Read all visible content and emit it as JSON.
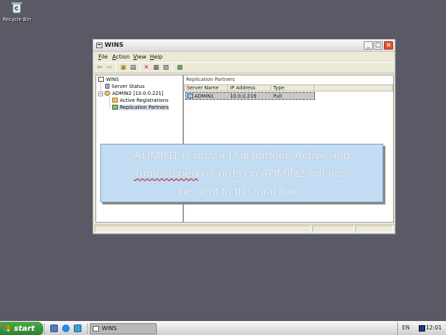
{
  "desktop": {
    "icons": [
      {
        "label": "Recycle Bin",
        "icon": "recycle-bin-icon"
      }
    ]
  },
  "window": {
    "title": "WINS",
    "menu": [
      "File",
      "Action",
      "View",
      "Help"
    ],
    "toolbar_icons": [
      "back-arrow-icon",
      "forward-arrow-icon",
      "up-folder-icon",
      "show-hide-tree-icon",
      "delete-icon",
      "properties-icon",
      "export-list-icon",
      "help-icon"
    ],
    "tree": {
      "root": "WINS",
      "server_status": "Server Status",
      "server": "ADMIN2 [10.0.0.221]",
      "active_registrations": "Active Registrations",
      "replication_partners": "Replication Partners"
    },
    "details": {
      "title": "Replication Partners",
      "columns": [
        "Server Name",
        "IP Address",
        "Type"
      ],
      "rows": [
        {
          "server_name": "ADMIN1",
          "ip_address": "10.0.0.219",
          "type": "Pull"
        }
      ]
    }
  },
  "callout": {
    "line1": "ADMIN1 is now a Pull partner. Active and",
    "line2_misspelled": "Tombstoned",
    "line2_rest": " records on ADMIN2 will now",
    "line3": "be sent to this machine."
  },
  "taskbar": {
    "start_label": "start",
    "quick_launch": [
      "show-desktop-icon",
      "internet-explorer-icon",
      "media-player-icon"
    ],
    "task_title": "WINS",
    "language": "EN",
    "time": "12:01"
  },
  "colors": {
    "desktop": "#5a5a66",
    "callout_bg": "#c2dcf4",
    "start_green": "#3a9a36"
  }
}
